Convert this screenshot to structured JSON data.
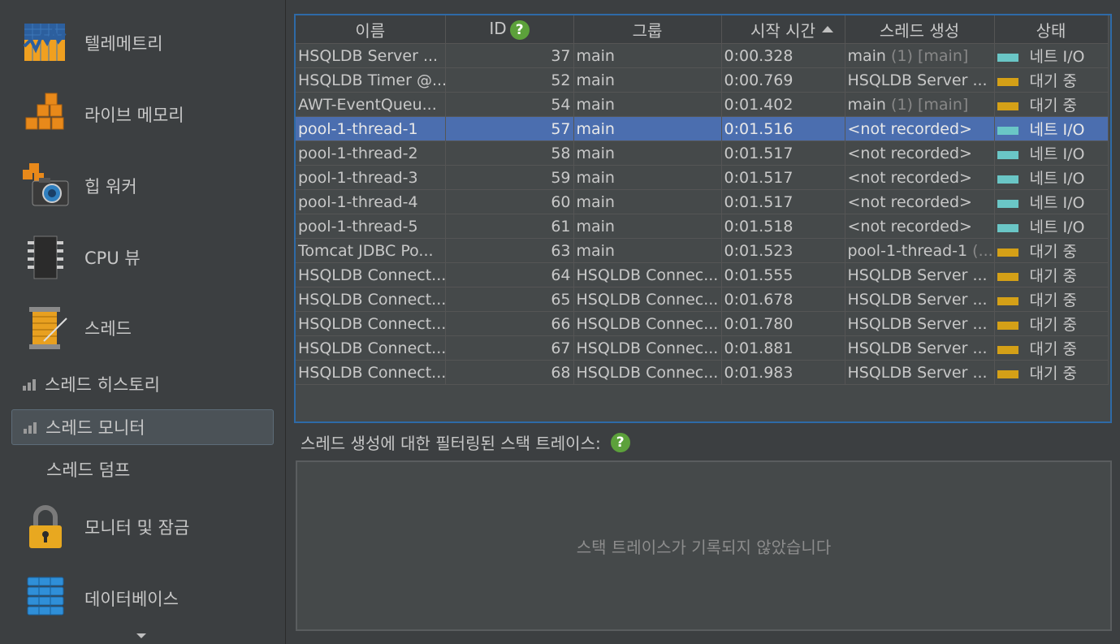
{
  "sidebar": {
    "items": [
      {
        "label": "텔레메트리",
        "icon": "telemetry-icon"
      },
      {
        "label": "라이브 메모리",
        "icon": "live-memory-icon"
      },
      {
        "label": "힙 워커",
        "icon": "heap-walker-icon"
      },
      {
        "label": "CPU 뷰",
        "icon": "cpu-views-icon"
      },
      {
        "label": "스레드",
        "icon": "threads-icon"
      }
    ],
    "thread_sub": [
      {
        "label": "스레드 히스토리",
        "icon": "bar-chart-icon"
      },
      {
        "label": "스레드 모니터",
        "icon": "bar-chart-icon",
        "selected": true
      },
      {
        "label": "스레드 덤프"
      }
    ],
    "items2": [
      {
        "label": "모니터 및 잠금",
        "icon": "padlock-icon"
      },
      {
        "label": "데이터베이스",
        "icon": "database-icon"
      }
    ]
  },
  "table": {
    "columns": [
      "이름",
      "ID",
      "그룹",
      "시작 시간",
      "스레드 생성",
      "상태"
    ],
    "sort_column": "시작 시간",
    "rows": [
      {
        "name": "HSQLDB Server ...",
        "id": "37",
        "group": "main",
        "start": "0:00.328",
        "creator": "main",
        "creator_extra": "(1) [main]",
        "state": "네트 I/O",
        "state_color": "#6ac6c6"
      },
      {
        "name": "HSQLDB Timer @...",
        "id": "52",
        "group": "main",
        "start": "0:00.769",
        "creator": "HSQLDB Server ...",
        "creator_extra": "",
        "state": "대기 중",
        "state_color": "#d4a017"
      },
      {
        "name": "AWT-EventQueu...",
        "id": "54",
        "group": "main",
        "start": "0:01.402",
        "creator": "main",
        "creator_extra": "(1) [main]",
        "state": "대기 중",
        "state_color": "#d4a017"
      },
      {
        "name": "pool-1-thread-1",
        "id": "57",
        "group": "main",
        "start": "0:01.516",
        "creator": "<not recorded>",
        "creator_extra": "",
        "state": "네트 I/O",
        "state_color": "#6ac6c6",
        "selected": true
      },
      {
        "name": "pool-1-thread-2",
        "id": "58",
        "group": "main",
        "start": "0:01.517",
        "creator": "<not recorded>",
        "creator_extra": "",
        "state": "네트 I/O",
        "state_color": "#6ac6c6"
      },
      {
        "name": "pool-1-thread-3",
        "id": "59",
        "group": "main",
        "start": "0:01.517",
        "creator": "<not recorded>",
        "creator_extra": "",
        "state": "네트 I/O",
        "state_color": "#6ac6c6"
      },
      {
        "name": "pool-1-thread-4",
        "id": "60",
        "group": "main",
        "start": "0:01.517",
        "creator": "<not recorded>",
        "creator_extra": "",
        "state": "네트 I/O",
        "state_color": "#6ac6c6"
      },
      {
        "name": "pool-1-thread-5",
        "id": "61",
        "group": "main",
        "start": "0:01.518",
        "creator": "<not recorded>",
        "creator_extra": "",
        "state": "네트 I/O",
        "state_color": "#6ac6c6"
      },
      {
        "name": "Tomcat JDBC Po...",
        "id": "63",
        "group": "main",
        "start": "0:01.523",
        "creator": "pool-1-thread-1",
        "creator_extra": "(...",
        "state": "대기 중",
        "state_color": "#d4a017"
      },
      {
        "name": "HSQLDB Connect...",
        "id": "64",
        "group": "HSQLDB Connec...",
        "start": "0:01.555",
        "creator": "HSQLDB Server ...",
        "creator_extra": "",
        "state": "대기 중",
        "state_color": "#d4a017"
      },
      {
        "name": "HSQLDB Connect...",
        "id": "65",
        "group": "HSQLDB Connec...",
        "start": "0:01.678",
        "creator": "HSQLDB Server ...",
        "creator_extra": "",
        "state": "대기 중",
        "state_color": "#d4a017"
      },
      {
        "name": "HSQLDB Connect...",
        "id": "66",
        "group": "HSQLDB Connec...",
        "start": "0:01.780",
        "creator": "HSQLDB Server ...",
        "creator_extra": "",
        "state": "대기 중",
        "state_color": "#d4a017"
      },
      {
        "name": "HSQLDB Connect...",
        "id": "67",
        "group": "HSQLDB Connec...",
        "start": "0:01.881",
        "creator": "HSQLDB Server ...",
        "creator_extra": "",
        "state": "대기 중",
        "state_color": "#d4a017"
      },
      {
        "name": "HSQLDB Connect...",
        "id": "68",
        "group": "HSQLDB Connec...",
        "start": "0:01.983",
        "creator": "HSQLDB Server ...",
        "creator_extra": "",
        "state": "대기 중",
        "state_color": "#d4a017"
      }
    ]
  },
  "trace": {
    "label": "스레드 생성에 대한 필터링된 스택 트레이스:",
    "empty_text": "스택 트레이스가 기록되지 않았습니다"
  },
  "help_glyph": "?"
}
